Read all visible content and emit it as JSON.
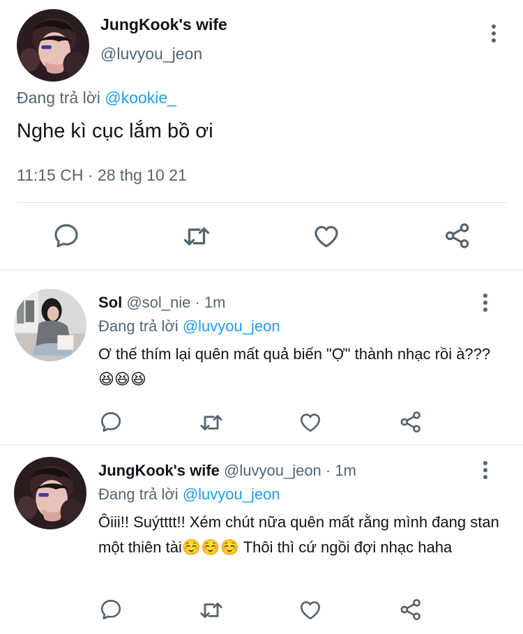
{
  "main_tweet": {
    "author_name": "JungKook's wife",
    "author_handle": "@luvyou_jeon",
    "replying_prefix": "Đang trả lời ",
    "replying_to": "@kookie_",
    "text": "Nghe kì cục lắm bồ ơi",
    "timestamp": "11:15 CH · 28 thg 10 21",
    "icons": [
      "comment-icon",
      "retweet-icon",
      "heart-icon",
      "share-icon"
    ]
  },
  "replies": [
    {
      "author_name": "Sol",
      "author_meta": " @sol_nie · 1m",
      "replying_prefix": "Đang trả lời ",
      "replying_to": "@luvyou_jeon",
      "text": "Ơ thế thím lại quên mất quả biến \"Ợ\" thành nhạc rồi à???😆😆😆"
    },
    {
      "author_name": "JungKook's wife",
      "author_meta": " @luvyou_jeon · 1m",
      "replying_prefix": "Đang trả lời ",
      "replying_to": "@luvyou_jeon",
      "text": "Ôiii!! Suýtttt!! Xém chút nữa quên mất rằng mình đang stan một thiên tài☺️☺️☺️ Thôi thì cứ ngồi đợi nhạc haha"
    }
  ],
  "colors": {
    "accent": "#1d9bf0",
    "secondary_text": "#536471",
    "primary_text": "#0f1419",
    "divider": "#eff3f4"
  }
}
